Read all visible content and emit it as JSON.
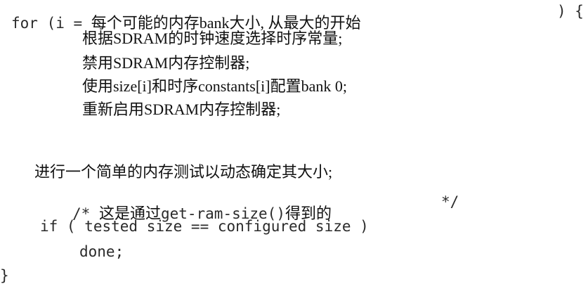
{
  "code": {
    "for_open": "for (i = ",
    "for_condition": "每个可能的内存bank大小, 从最大的开始",
    "for_close": ") {",
    "body": [
      "根据SDRAM的时钟速度选择时序常量;",
      "禁用SDRAM内存控制器;",
      "使用size[i]和时序constants[i]配置bank 0;",
      "重新启用SDRAM内存控制器;"
    ],
    "test_statement": "进行一个简单的内存测试以动态确定其大小;",
    "comment_open": "/* ",
    "comment_text": "这是通过",
    "comment_code": "get-ram-size()",
    "comment_tail": "得到的",
    "comment_close": "*/",
    "if_line": "if ( tested size == configured size )",
    "done_line": "done;",
    "closing_brace": "}"
  }
}
